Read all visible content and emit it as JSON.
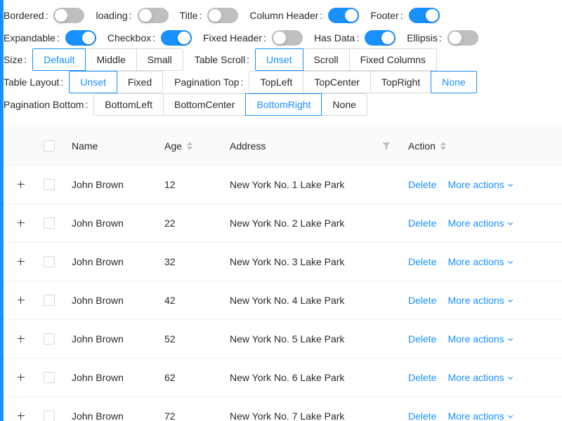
{
  "controls": {
    "bordered": {
      "label": "Bordered",
      "on": false
    },
    "loading": {
      "label": "loading",
      "on": false
    },
    "title": {
      "label": "Title",
      "on": false
    },
    "column_header": {
      "label": "Column Header",
      "on": true
    },
    "footer": {
      "label": "Footer",
      "on": true
    },
    "expandable": {
      "label": "Expandable",
      "on": true
    },
    "checkbox": {
      "label": "Checkbox",
      "on": true
    },
    "fixed_header": {
      "label": "Fixed Header",
      "on": false
    },
    "has_data": {
      "label": "Has Data",
      "on": true
    },
    "ellipsis": {
      "label": "Ellipsis",
      "on": false
    },
    "size": {
      "label": "Size",
      "options": [
        "Default",
        "Middle",
        "Small"
      ],
      "selected": "Default"
    },
    "table_scroll": {
      "label": "Table Scroll",
      "options": [
        "Unset",
        "Scroll",
        "Fixed Columns"
      ],
      "selected": "Unset"
    },
    "table_layout": {
      "label": "Table Layout",
      "options": [
        "Unset",
        "Fixed"
      ],
      "selected": "Unset"
    },
    "pagination_top": {
      "label": "Pagination Top",
      "options": [
        "TopLeft",
        "TopCenter",
        "TopRight",
        "None"
      ],
      "selected": "None"
    },
    "pagination_bottom": {
      "label": "Pagination Bottom",
      "options": [
        "BottomLeft",
        "BottomCenter",
        "BottomRight",
        "None"
      ],
      "selected": "BottomRight"
    }
  },
  "table": {
    "headers": {
      "name": "Name",
      "age": "Age",
      "address": "Address",
      "action": "Action"
    },
    "rows": [
      {
        "name": "John Brown",
        "age": "12",
        "address": "New York No. 1 Lake Park"
      },
      {
        "name": "John Brown",
        "age": "22",
        "address": "New York No. 2 Lake Park"
      },
      {
        "name": "John Brown",
        "age": "32",
        "address": "New York No. 3 Lake Park"
      },
      {
        "name": "John Brown",
        "age": "42",
        "address": "New York No. 4 Lake Park"
      },
      {
        "name": "John Brown",
        "age": "52",
        "address": "New York No. 5 Lake Park"
      },
      {
        "name": "John Brown",
        "age": "62",
        "address": "New York No. 6 Lake Park"
      },
      {
        "name": "John Brown",
        "age": "72",
        "address": "New York No. 7 Lake Park"
      }
    ],
    "delete_label": "Delete",
    "more_label": "More actions"
  },
  "colors": {
    "accent": "#1890ff",
    "switch_off": "#bfbfbf",
    "border": "#d9d9d9",
    "header_bg": "#fafafa"
  }
}
